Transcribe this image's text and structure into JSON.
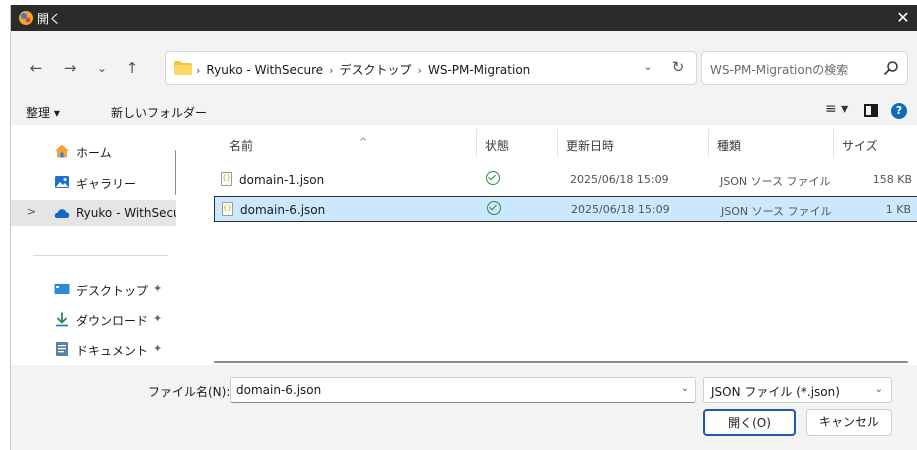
{
  "window": {
    "title": "開く",
    "close_glyph": "✕"
  },
  "nav": {
    "back_glyph": "←",
    "forward_glyph": "→",
    "recent_glyph": "⌄",
    "up_glyph": "↑",
    "breadcrumb": [
      "Ryuko - WithSecure",
      "デスクトップ",
      "WS-PM-Migration"
    ],
    "separator": "›",
    "dropdown_glyph": "⌄",
    "refresh_glyph": "↻",
    "search_placeholder": "WS-PM-Migrationの検索"
  },
  "toolbar": {
    "organize_label": "整理 ▾",
    "new_folder_label": "新しいフォルダー",
    "view_label": "≡ ▾",
    "help_label": "?"
  },
  "sidebar": {
    "items": [
      {
        "label": "ホーム",
        "icon": "home-icon",
        "pinned": false
      },
      {
        "label": "ギャラリー",
        "icon": "gallery-icon",
        "pinned": false
      },
      {
        "label": "Ryuko - WithSecu",
        "icon": "cloud-icon",
        "pinned": false,
        "selected": true,
        "expand": ">"
      },
      {
        "label": "デスクトップ",
        "icon": "desktop-icon",
        "pinned": true
      },
      {
        "label": "ダウンロード",
        "icon": "download-icon",
        "pinned": true
      },
      {
        "label": "ドキュメント",
        "icon": "document-icon",
        "pinned": true
      }
    ],
    "pin_glyph": "✦"
  },
  "columns": {
    "name": "名前",
    "status": "状態",
    "date": "更新日時",
    "type": "種類",
    "size": "サイズ",
    "sort_glyph": "^"
  },
  "files": [
    {
      "name": "domain-1.json",
      "date": "2025/06/18 15:09",
      "type": "JSON ソース ファイル",
      "size": "158 KB",
      "selected": false
    },
    {
      "name": "domain-6.json",
      "date": "2025/06/18 15:09",
      "type": "JSON ソース ファイル",
      "size": "1 KB",
      "selected": true
    }
  ],
  "footer": {
    "filename_label": "ファイル名(N):",
    "filename_value": "domain-6.json",
    "filetype_value": "JSON ファイル (*.json)",
    "open_label": "開く(O)",
    "cancel_label": "キャンセル",
    "dropdown_glyph": "⌄"
  },
  "colors": {
    "titlebar": "#2b2b2b",
    "selection": "#cce8ff",
    "status_ok": "#2e8b3e",
    "accent": "#0f6cbd"
  }
}
